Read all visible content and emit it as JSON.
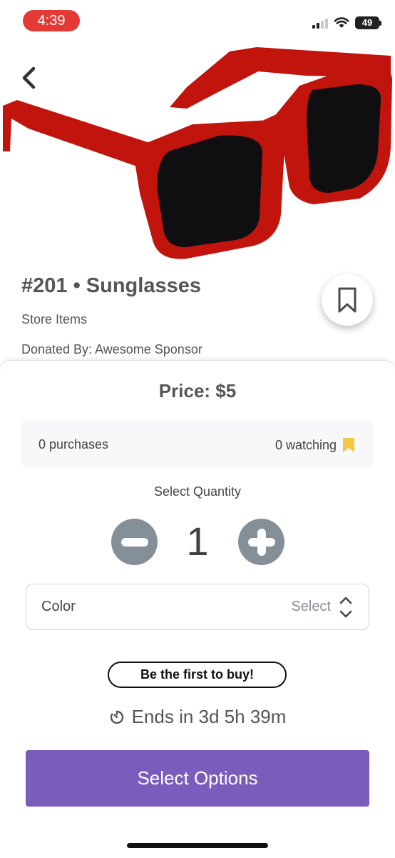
{
  "status_bar": {
    "time": "4:39",
    "battery": "49"
  },
  "item": {
    "title": "#201 • Sunglasses",
    "category": "Store Items",
    "donor": "Donated By: Awesome Sponsor"
  },
  "price": "Price: $5",
  "stats": {
    "purchases": "0 purchases",
    "watching": "0 watching"
  },
  "quantity": {
    "label": "Select Quantity",
    "value": "1"
  },
  "color_field": {
    "label": "Color",
    "value": "Select"
  },
  "badge": "Be the first to buy!",
  "ends": "Ends in 3d 5h 39m",
  "cta": "Select Options",
  "colors": {
    "accent": "#7b5cbd",
    "time_pill": "#e53935",
    "watch_icon": "#f5c842",
    "frame": "#c0140c"
  },
  "icons": [
    "back-chevron-icon",
    "bookmark-icon",
    "minus-icon",
    "plus-icon",
    "chevron-up-down-icon",
    "timer-icon",
    "bookmark-filled-icon"
  ]
}
